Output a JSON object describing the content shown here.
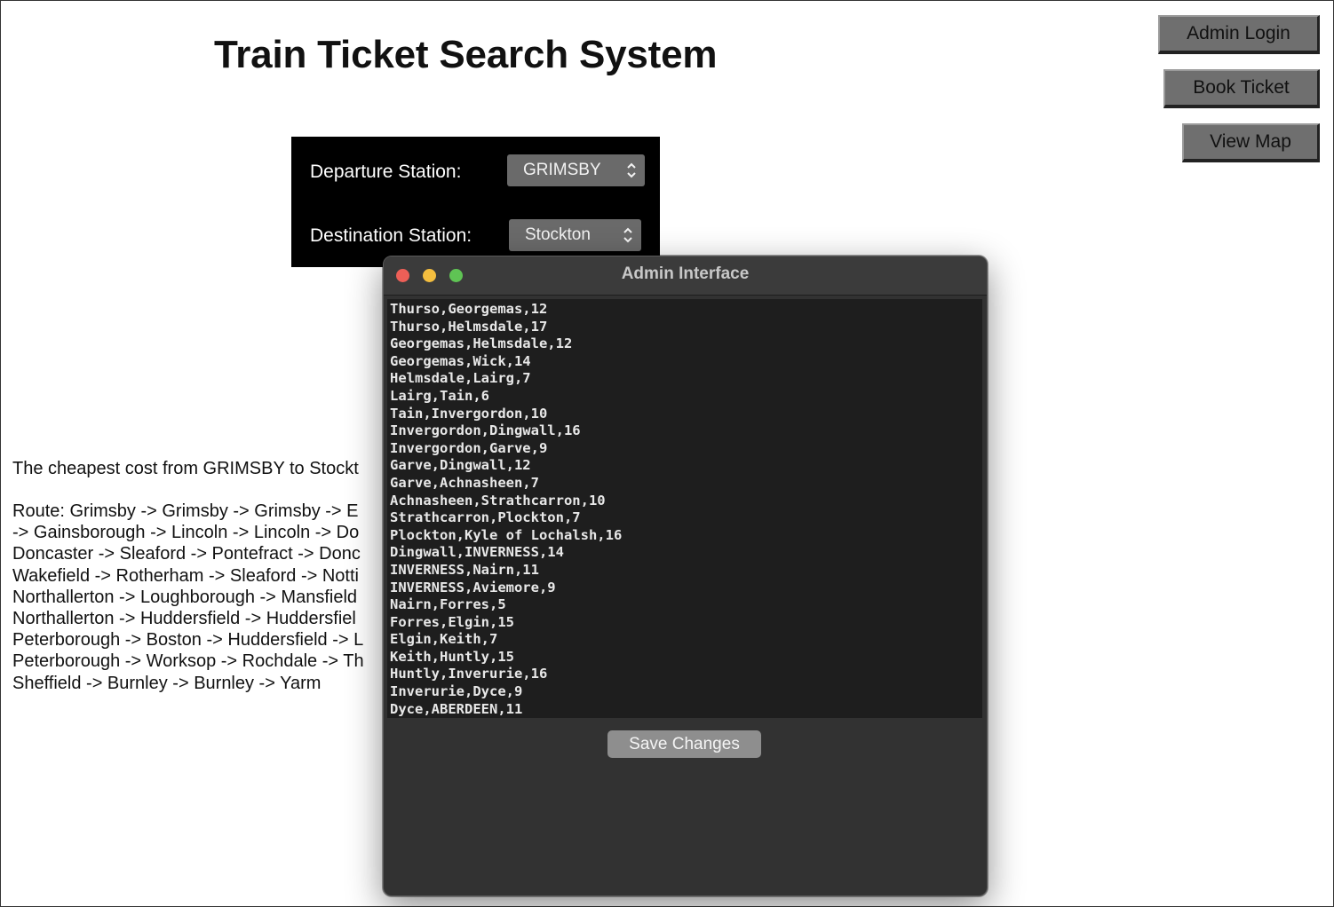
{
  "app": {
    "title": "Train Ticket Search System"
  },
  "nav": {
    "admin_login": "Admin Login",
    "book_ticket": "Book Ticket",
    "view_map": "View Map"
  },
  "search": {
    "departure_label": "Departure Station:",
    "departure_value": "GRIMSBY",
    "destination_label": "Destination Station:",
    "destination_value": "Stockton"
  },
  "result": {
    "cost_text": "The cheapest cost from GRIMSBY to Stockt",
    "route_lines": [
      " Route: Grimsby -> Grimsby -> Grimsby -> E",
      "-> Gainsborough -> Lincoln -> Lincoln -> Do",
      "Doncaster -> Sleaford -> Pontefract -> Donc",
      "Wakefield -> Rotherham -> Sleaford -> Notti",
      "Northallerton -> Loughborough -> Mansfield",
      "Northallerton -> Huddersfield -> Huddersfiel",
      "Peterborough -> Boston -> Huddersfield -> L",
      "Peterborough -> Worksop -> Rochdale -> Th",
      "Sheffield -> Burnley -> Burnley -> Yarm"
    ]
  },
  "admin_window": {
    "title": "Admin Interface",
    "lines": [
      "Thurso,Georgemas,12",
      "Thurso,Helmsdale,17",
      "Georgemas,Helmsdale,12",
      "Georgemas,Wick,14",
      "Helmsdale,Lairg,7",
      "Lairg,Tain,6",
      "Tain,Invergordon,10",
      "Invergordon,Dingwall,16",
      "Invergordon,Garve,9",
      "Garve,Dingwall,12",
      "Garve,Achnasheen,7",
      "Achnasheen,Strathcarron,10",
      "Strathcarron,Plockton,7",
      "Plockton,Kyle of Lochalsh,16",
      "Dingwall,INVERNESS,14",
      "INVERNESS,Nairn,11",
      "INVERNESS,Aviemore,9",
      "Nairn,Forres,5",
      "Forres,Elgin,15",
      "Elgin,Keith,7",
      "Keith,Huntly,15",
      "Huntly,Inverurie,16",
      "Inverurie,Dyce,9",
      "Dyce,ABERDEEN,11"
    ],
    "save_label": "Save Changes"
  },
  "colors": {
    "traffic_close": "#ed5f57",
    "traffic_minimize": "#f4be3f",
    "traffic_maximize": "#5fc454"
  }
}
